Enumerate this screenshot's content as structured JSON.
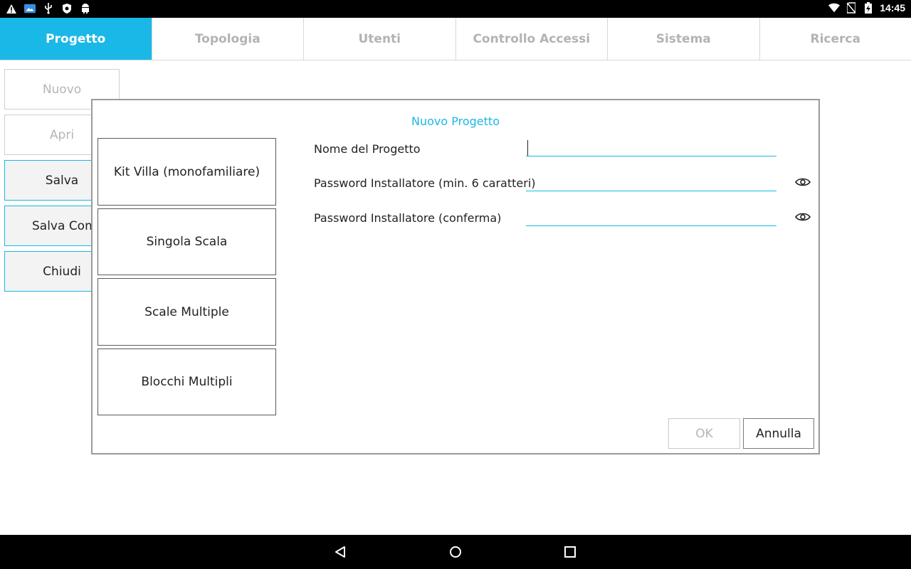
{
  "status_bar": {
    "left_icons": [
      "warning-icon",
      "image-app-icon",
      "usb-icon",
      "shield-icon",
      "android-icon"
    ],
    "right_icons": [
      "wifi-icon",
      "no-sim-icon",
      "battery-charging-icon"
    ],
    "time": "14:45"
  },
  "tabs": [
    {
      "label": "Progetto",
      "active": true
    },
    {
      "label": "Topologia",
      "active": false
    },
    {
      "label": "Utenti",
      "active": false
    },
    {
      "label": "Controllo Accessi",
      "active": false
    },
    {
      "label": "Sistema",
      "active": false
    },
    {
      "label": "Ricerca",
      "active": false
    }
  ],
  "side_menu": {
    "nuovo": "Nuovo",
    "apri": "Apri",
    "salva": "Salva",
    "salva_come": "Salva Come",
    "chiudi": "Chiudi"
  },
  "dialog": {
    "title": "Nuovo Progetto",
    "templates": [
      "Kit Villa (monofamiliare)",
      "Singola Scala",
      "Scale Multiple",
      "Blocchi Multipli"
    ],
    "fields": {
      "project_name_label": "Nome del Progetto",
      "project_name_value": "",
      "password_label": "Password Installatore (min. 6 caratteri)",
      "password_value": "",
      "password_confirm_label": "Password Installatore (conferma)",
      "password_confirm_value": ""
    },
    "ok_label": "OK",
    "cancel_label": "Annulla"
  },
  "colors": {
    "accent": "#1ab8e6",
    "disabled_text": "#b5b5b5"
  }
}
